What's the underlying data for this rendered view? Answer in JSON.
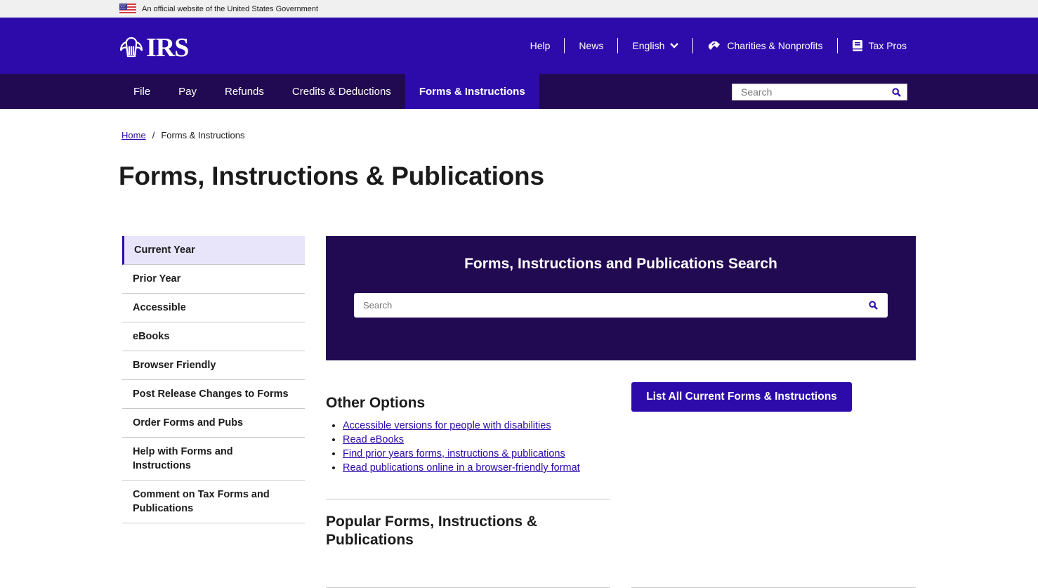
{
  "official_banner": {
    "text": "An official website of the United States Government",
    "flag_icon": "us-flag-icon"
  },
  "header": {
    "logo_text": "IRS",
    "utility_links": [
      {
        "label": "Help"
      },
      {
        "label": "News"
      },
      {
        "label": "English",
        "icon": "chevron-down-icon"
      },
      {
        "label": "Charities & Nonprofits",
        "icon": "handshake-icon"
      },
      {
        "label": "Tax Pros",
        "icon": "book-icon"
      }
    ],
    "colors": {
      "top_bar": "#2d0bab",
      "nav_bar": "#220a52"
    }
  },
  "nav": {
    "items": [
      {
        "label": "File"
      },
      {
        "label": "Pay"
      },
      {
        "label": "Refunds"
      },
      {
        "label": "Credits & Deductions"
      },
      {
        "label": "Forms & Instructions",
        "active": true
      }
    ],
    "search_placeholder": "Search"
  },
  "breadcrumb": {
    "home": "Home",
    "separator": "/",
    "current": "Forms & Instructions"
  },
  "page_title": "Forms, Instructions & Publications",
  "sidebar": {
    "items": [
      {
        "label": "Current Year",
        "active": true
      },
      {
        "label": "Prior Year"
      },
      {
        "label": "Accessible"
      },
      {
        "label": "eBooks"
      },
      {
        "label": "Browser Friendly"
      },
      {
        "label": "Post Release Changes to Forms"
      },
      {
        "label": "Order Forms and Pubs"
      },
      {
        "label": "Help with Forms and Instructions"
      },
      {
        "label": "Comment on Tax Forms and Publications"
      }
    ]
  },
  "search_panel": {
    "title": "Forms, Instructions and Publications Search",
    "placeholder": "Search"
  },
  "other_options": {
    "heading": "Other Options",
    "links": [
      "Accessible versions for people with disabilities",
      "Read eBooks",
      "Find prior years forms, instructions & publications",
      "Read publications online in a browser-friendly format"
    ]
  },
  "list_all_button": "List All Current Forms & Instructions",
  "popular_heading": "Popular Forms, Instructions & Publications"
}
